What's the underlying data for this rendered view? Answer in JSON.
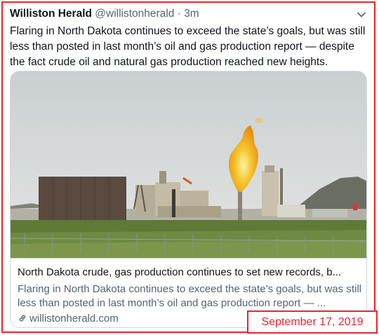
{
  "tweet": {
    "author_name": "Williston Herald",
    "author_handle": "@willistonherald",
    "separator": "·",
    "time": "3m",
    "text": "Flaring in North Dakota continues to exceed the state’s goals, but was still less than posted in last month’s oil and gas production report — despite the fact crude oil and natural gas production reached new heights."
  },
  "card": {
    "title": "North Dakota crude, gas production continues to set new records, b...",
    "description": "Flaring in North Dakota continues to exceed the state’s goals, but was still less than posted in last month’s oil and gas production report — ...",
    "domain": "willistonherald.com"
  },
  "annotation": {
    "date": "September 17, 2019",
    "color": "#e8262a"
  },
  "colors": {
    "text_primary": "#0f1419",
    "text_secondary": "#536471",
    "card_border": "#cfd9de"
  },
  "icons": [
    "chevron-down-icon",
    "link-icon"
  ]
}
